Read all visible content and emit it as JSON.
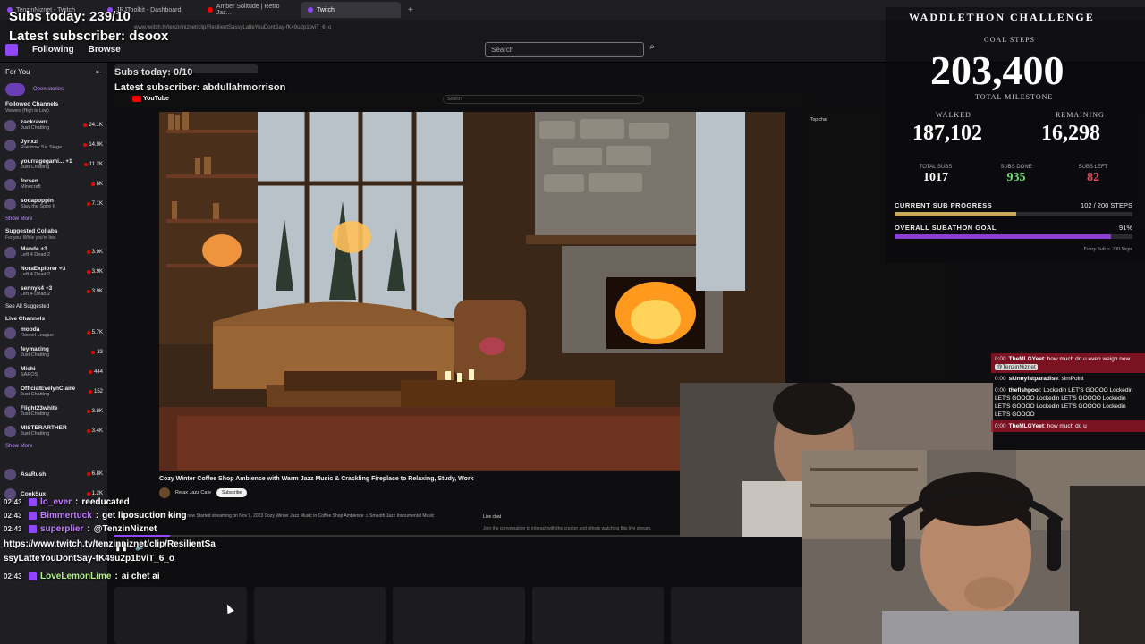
{
  "browser": {
    "tabs": [
      {
        "label": "TenzinNiznet - Twitch",
        "active": false
      },
      {
        "label": "JRJToolkit - Dashboard",
        "active": false
      },
      {
        "label": "Amber Solitude | Retro Jaz...",
        "active": false
      },
      {
        "label": "Twitch",
        "active": true
      }
    ],
    "url": "www.twitch.tv/tenzinniznet/clip/ResilientSassyLatteYouDontSay-fK49u2p1bviT_6_o"
  },
  "nav": {
    "following": "Following",
    "browse": "Browse",
    "search_placeholder": "Search"
  },
  "sidebar": {
    "for_you": "For You",
    "open_stories": "Open stories",
    "followed_header": "Followed Channels",
    "followed_sub": "Viewers (High to Low)",
    "followed": [
      {
        "name": "zackrawrr",
        "game": "Just Chatting",
        "viewers": "24.1K"
      },
      {
        "name": "Jynxzi",
        "game": "Rainbow Six Siege",
        "viewers": "14.9K"
      },
      {
        "name": "yourragegami... +1",
        "game": "Just Chatting",
        "viewers": "11.2K"
      },
      {
        "name": "forsen",
        "game": "Minecraft",
        "viewers": "8K"
      },
      {
        "name": "sodapoppin",
        "game": "Slay the Spire II",
        "viewers": "7.1K"
      }
    ],
    "show_more": "Show More",
    "collabs_header": "Suggested Collabs",
    "collabs_sub": "For you. While you're live.",
    "collabs": [
      {
        "name": "Mande +3",
        "game": "Left 4 Dead 2",
        "viewers": "3.9K"
      },
      {
        "name": "NoraExplorer +3",
        "game": "Left 4 Dead 2",
        "viewers": "3.9K"
      },
      {
        "name": "sennyk4 +3",
        "game": "Left 4 Dead 2",
        "viewers": "3.9K"
      }
    ],
    "see_all": "See All Suggested",
    "live_header": "Live Channels",
    "live": [
      {
        "name": "mooda",
        "game": "Rocket League",
        "viewers": "5.7K"
      },
      {
        "name": "feymazing",
        "game": "Just Chatting",
        "viewers": "33"
      },
      {
        "name": "Michi",
        "game": "SAROS",
        "viewers": "444"
      },
      {
        "name": "OfficialEvelynClaire",
        "game": "Just Chatting",
        "viewers": "152"
      },
      {
        "name": "Flight23white",
        "game": "Just Chatting",
        "viewers": "3.8K"
      },
      {
        "name": "MISTERARTHER",
        "game": "Just Chatting",
        "viewers": "3.4K"
      }
    ],
    "show_more_2": "Show More",
    "extra": [
      {
        "name": "AsaRush",
        "viewers": "6.8K"
      },
      {
        "name": "CookSux",
        "viewers": "1.2K"
      }
    ]
  },
  "overlay": {
    "subs_today": "Subs today: 239/10",
    "latest_subscriber": "Latest subscriber: dsoox",
    "subs_today_2": "Subs today: 0/10",
    "latest_subscriber_2": "Latest subscriber: abdullahmorrison"
  },
  "youtube": {
    "logo": "YouTube",
    "search_placeholder": "Search",
    "video_title": "Cozy Winter Coffee Shop Ambience with Warm Jazz Music & Crackling Fireplace to Relaxing, Study, Work",
    "channel": "Relax Jazz Cafe",
    "subscribe": "Subscribe",
    "description": "150 watching now  Started streaming on Nov 9, 2023  Cozy Winter Jazz Music in Coffee Shop Ambience ♫ Smooth Jazz Instrumental Music",
    "live_chat": "Live chat",
    "join_text": "Join the conversation to interact with the creator and others watching this live stream.",
    "top_chat": "Top chat",
    "progress_fraction": 0.08
  },
  "waddlethon": {
    "title": "WADDLETHON CHALLENGE",
    "goal_steps_label": "GOAL STEPS",
    "goal_steps": "203,400",
    "total_milestone": "TOTAL MILESTONE",
    "walked_label": "WALKED",
    "walked": "187,102",
    "remaining_label": "REMAINING",
    "remaining": "16,298",
    "total_subs_label": "TOTAL SUBS",
    "total_subs": "1017",
    "subs_done_label": "SUBS DONE",
    "subs_done": "935",
    "subs_left_label": "SUBS LEFT",
    "subs_left": "82",
    "current_sub_progress_label": "CURRENT SUB PROGRESS",
    "current_sub_progress_value": "102 / 200 STEPS",
    "current_sub_fraction": 0.51,
    "overall_goal_label": "OVERALL SUBATHON GOAL",
    "overall_goal_value": "91%",
    "overall_goal_fraction": 0.91,
    "footnote": "Every Sub = 200 Steps",
    "colors": {
      "current": "#c8a85a",
      "overall": "#8a3fd1",
      "subs_done": "#6ee06e",
      "subs_left": "#e04a5a"
    }
  },
  "chat_right": [
    {
      "time": "0:00",
      "user": "TheMLGYeet",
      "text": "how much do u even weigh now",
      "mention": "@TenzinNiznet",
      "highlight": true
    },
    {
      "time": "0:00",
      "user": "skinnyfatparadise",
      "text": "simPoint",
      "mention": "",
      "highlight": false
    },
    {
      "time": "0:00",
      "user": "thefishpool",
      "text": "Lockedin LET'S GOOOO Lockedin LET'S GOOOO Lockedin LET'S GOOOO Lockedin LET'S GOOOO Lockedin LET'S GOOOO Lockedin LET'S GOOOO",
      "mention": "",
      "highlight": false
    },
    {
      "time": "0:00",
      "user": "TheMLGYeet",
      "text": "how much do u",
      "mention": "",
      "highlight": true
    }
  ],
  "chat_left": [
    {
      "time": "02:43",
      "user": "lo_ever",
      "text": "reeducated"
    },
    {
      "time": "02:43",
      "user": "Bimmertuck",
      "text": "get liposuction king"
    },
    {
      "time": "02:43",
      "user": "superplier",
      "text": "@TenzinNiznet"
    },
    {
      "url": "https://www.twitch.tv/tenzinniznet/clip/ResilientSassyLatteYouDontSay-fK49u2p1bviT_6_o"
    },
    {
      "time": "02:43",
      "user": "LoveLemonLime",
      "text": "ai chet ai"
    }
  ]
}
